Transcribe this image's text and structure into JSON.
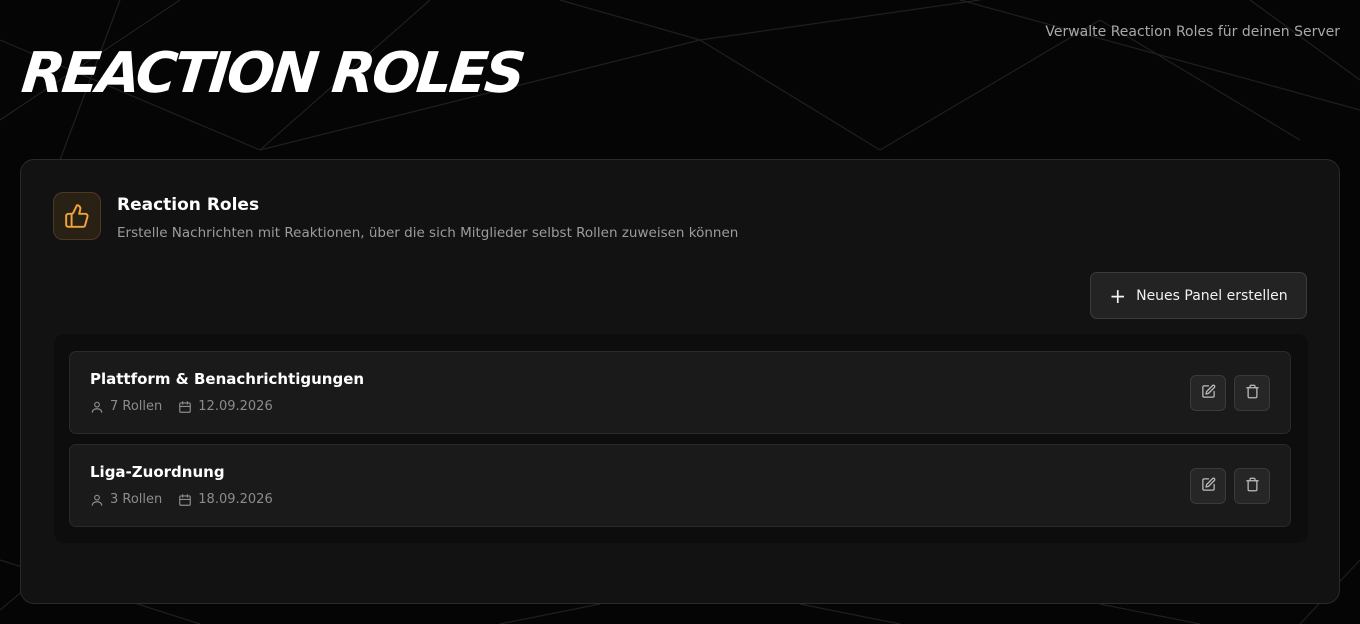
{
  "header": {
    "title": "REACTION ROLES",
    "subtitle": "Verwalte Reaction Roles für deinen Server"
  },
  "card": {
    "icon": "thumbs-up-icon",
    "title": "Reaction Roles",
    "description": "Erstelle Nachrichten mit Reaktionen, über die sich Mitglieder selbst Rollen zuweisen können",
    "new_panel_label": "Neues Panel erstellen"
  },
  "panels": [
    {
      "name": "Plattform & Benachrichtigungen",
      "roles": "7 Rollen",
      "date": "12.09.2026"
    },
    {
      "name": "Liga-Zuordnung",
      "roles": "3 Rollen",
      "date": "18.09.2026"
    }
  ],
  "colors": {
    "accent": "#f0a43a",
    "background": "#050505",
    "card": "#121212"
  }
}
